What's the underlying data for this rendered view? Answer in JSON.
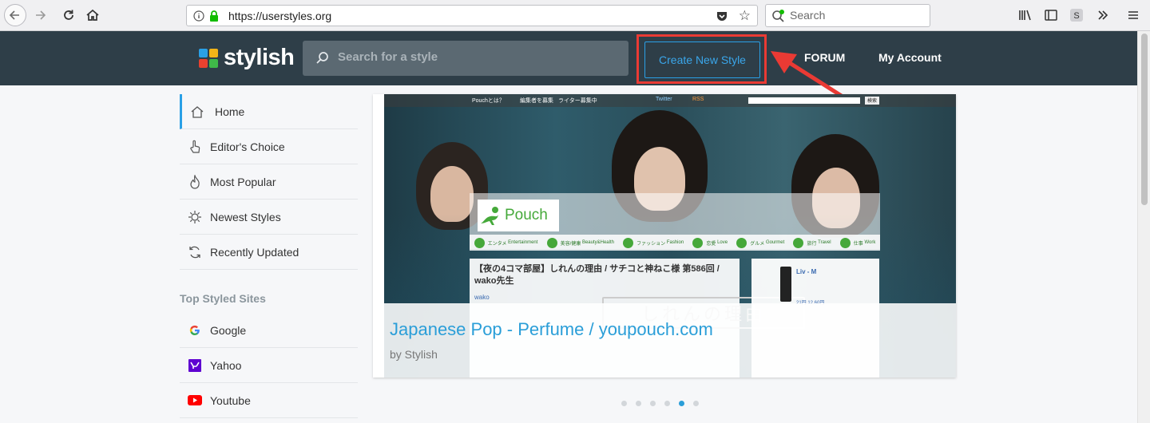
{
  "browser": {
    "url": "https://userstyles.org",
    "search_placeholder": "Search"
  },
  "site": {
    "logo_text": "stylish",
    "search_placeholder": "Search for a style",
    "create_label": "Create New Style",
    "forum_label": "FORUM",
    "account_label": "My Account"
  },
  "sidebar": {
    "nav": [
      {
        "label": "Home",
        "icon": "home-icon"
      },
      {
        "label": "Editor's Choice",
        "icon": "pointer-hand-icon"
      },
      {
        "label": "Most Popular",
        "icon": "flame-icon"
      },
      {
        "label": "Newest Styles",
        "icon": "sparkle-icon"
      },
      {
        "label": "Recently Updated",
        "icon": "refresh-icon"
      }
    ],
    "sites_heading": "Top Styled Sites",
    "sites": [
      {
        "label": "Google",
        "icon": "google-icon"
      },
      {
        "label": "Yahoo",
        "icon": "yahoo-icon"
      },
      {
        "label": "Youtube",
        "icon": "youtube-icon"
      }
    ]
  },
  "slider": {
    "title": "Japanese Pop - Perfume / youpouch.com",
    "author": "by Stylish",
    "active_dot": 5,
    "dot_count": 6,
    "preview": {
      "top_links": [
        "Pouchとは？",
        "編集者を募集",
        "ライター募集中"
      ],
      "twitter": "Twitter",
      "rss": "RSS",
      "search_btn": "検索",
      "brand": "Pouch",
      "categories": [
        {
          "jp": "エンタメ",
          "en": "Entertainment"
        },
        {
          "jp": "美容/健康",
          "en": "Beauty&Health"
        },
        {
          "jp": "ファッション",
          "en": "Fashion"
        },
        {
          "jp": "恋愛",
          "en": "Love"
        },
        {
          "jp": "グルメ",
          "en": "Gourmet"
        },
        {
          "jp": "旅行",
          "en": "Travel"
        },
        {
          "jp": "仕事",
          "en": "Work"
        }
      ],
      "headline": "【夜の4コマ部屋】しれんの理由 / サチコと神ねこ様 第586回 / wako先生",
      "author": "wako",
      "ad_title": "Liv - M",
      "ad_price": "21円 12.60円",
      "sketch_text": "しれんの理由"
    }
  },
  "colors": {
    "header_bg": "#2e3e48",
    "accent": "#2aa0e6",
    "highlight": "#ea3a34"
  }
}
